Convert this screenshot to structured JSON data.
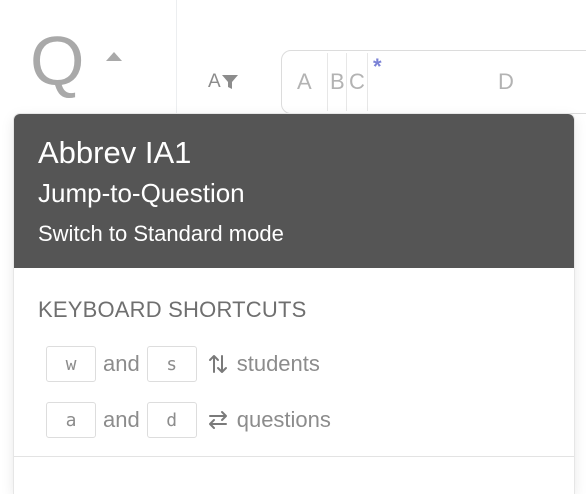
{
  "question_header": {
    "letter": "Q",
    "collapse_icon": "caret-up-icon",
    "sort_label": "A",
    "sort_icon": "filter-funnel-icon"
  },
  "answer_choices": {
    "options": [
      "A",
      "B",
      "C",
      "D"
    ],
    "marker": "*",
    "marker_color": "#7b82d6"
  },
  "popover": {
    "title": "Abbrev IA1",
    "subtitle": "Jump-to-Question",
    "switch_mode": "Switch to Standard mode",
    "header_bg": "#555555",
    "shortcuts": {
      "title": "KEYBOARD SHORTCUTS",
      "rows": [
        {
          "key1": "w",
          "conj": "and",
          "key2": "s",
          "icon": "up-down-arrows-icon",
          "label": "students"
        },
        {
          "key1": "a",
          "conj": "and",
          "key2": "d",
          "icon": "left-right-arrows-icon",
          "label": "questions"
        }
      ]
    }
  }
}
